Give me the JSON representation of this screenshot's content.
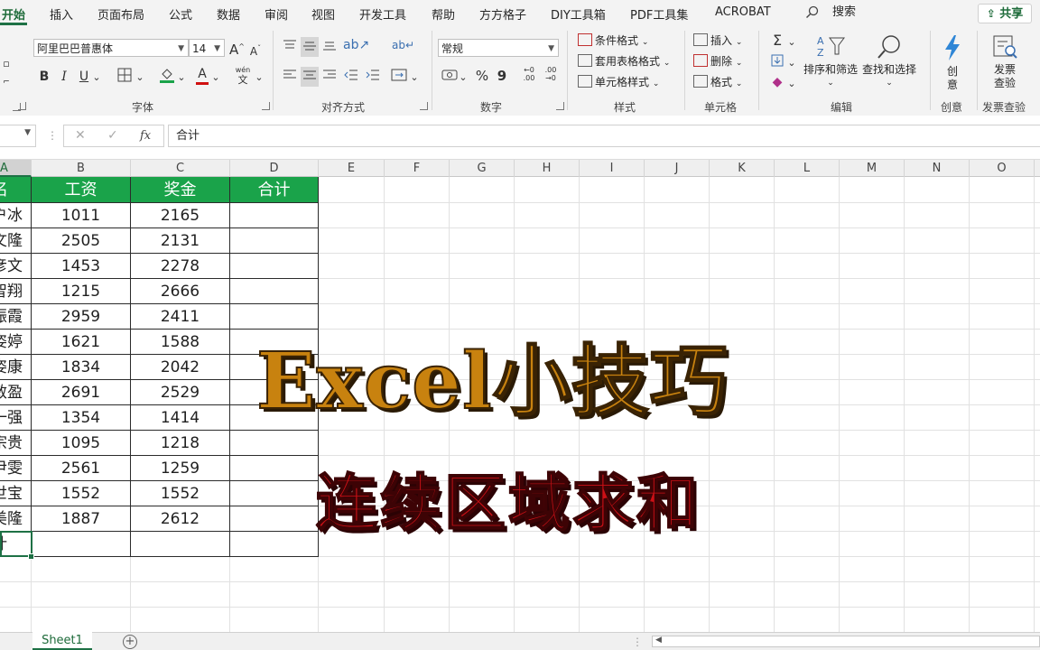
{
  "menu": {
    "tabs": [
      "开始",
      "插入",
      "页面布局",
      "公式",
      "数据",
      "审阅",
      "视图",
      "开发工具",
      "帮助",
      "方方格子",
      "DIY工具箱",
      "PDF工具集",
      "ACROBAT"
    ],
    "search_label": "搜索",
    "share_label": "共享"
  },
  "ribbon": {
    "font": {
      "name": "阿里巴巴普惠体",
      "size": "14",
      "grow": "A",
      "shrink": "A",
      "bold": "B",
      "italic": "I",
      "underline": "U",
      "font_color_letter": "A",
      "wen": "wén",
      "wen_char": "文",
      "group_label": "字体"
    },
    "alignment": {
      "group_label": "对齐方式"
    },
    "number": {
      "format": "常规",
      "percent": "%",
      "comma": "9",
      "group_label": "数字"
    },
    "styles": {
      "conditional": "条件格式",
      "table_format": "套用表格格式",
      "cell_styles": "单元格样式",
      "group_label": "样式"
    },
    "cells": {
      "insert": "插入",
      "delete": "删除",
      "format": "格式",
      "group_label": "单元格"
    },
    "editing": {
      "sigma": "Σ",
      "sort_filter": "排序和筛选",
      "find_select": "查找和选择",
      "group_label": "编辑"
    },
    "creative": {
      "label_line1": "创",
      "label_line2": "意",
      "group_label": "创意"
    },
    "invoice": {
      "label_line1": "发票",
      "label_line2": "查验",
      "group_label": "发票查验"
    }
  },
  "formula_bar": {
    "content": "合计",
    "cancel": "✕",
    "enter": "✓",
    "fx": "fx"
  },
  "columns": [
    "A",
    "B",
    "C",
    "D",
    "E",
    "F",
    "G",
    "H",
    "I",
    "J",
    "K",
    "L",
    "M",
    "N",
    "O"
  ],
  "table": {
    "headers": [
      "名",
      "工资",
      "奖金",
      "合计"
    ],
    "rows": [
      [
        "户冰",
        "1011",
        "2165",
        ""
      ],
      [
        "文隆",
        "2505",
        "2131",
        ""
      ],
      [
        "彦文",
        "1453",
        "2278",
        ""
      ],
      [
        "智翔",
        "1215",
        "2666",
        ""
      ],
      [
        "振霞",
        "2959",
        "2411",
        ""
      ],
      [
        "姿婷",
        "1621",
        "1588",
        ""
      ],
      [
        "姿康",
        "1834",
        "2042",
        ""
      ],
      [
        "敏盈",
        "2691",
        "2529",
        ""
      ],
      [
        "一强",
        "1354",
        "1414",
        ""
      ],
      [
        "宗贵",
        "1095",
        "1218",
        ""
      ],
      [
        "尹雯",
        "2561",
        "1259",
        ""
      ],
      [
        "世宝",
        "1552",
        "1552",
        ""
      ],
      [
        "美隆",
        "1887",
        "2612",
        ""
      ]
    ],
    "total_row": [
      "计",
      "",
      "",
      ""
    ]
  },
  "overlay": {
    "title": "Excel小技巧",
    "subtitle": "连续区域求和",
    "title_color": "#c8820f",
    "subtitle_color": "#cc1016"
  },
  "sheets": [
    "Sheet1"
  ],
  "add_sheet": "+",
  "colors": {
    "accent": "#1e7145",
    "header_fill": "#1aa34a"
  }
}
